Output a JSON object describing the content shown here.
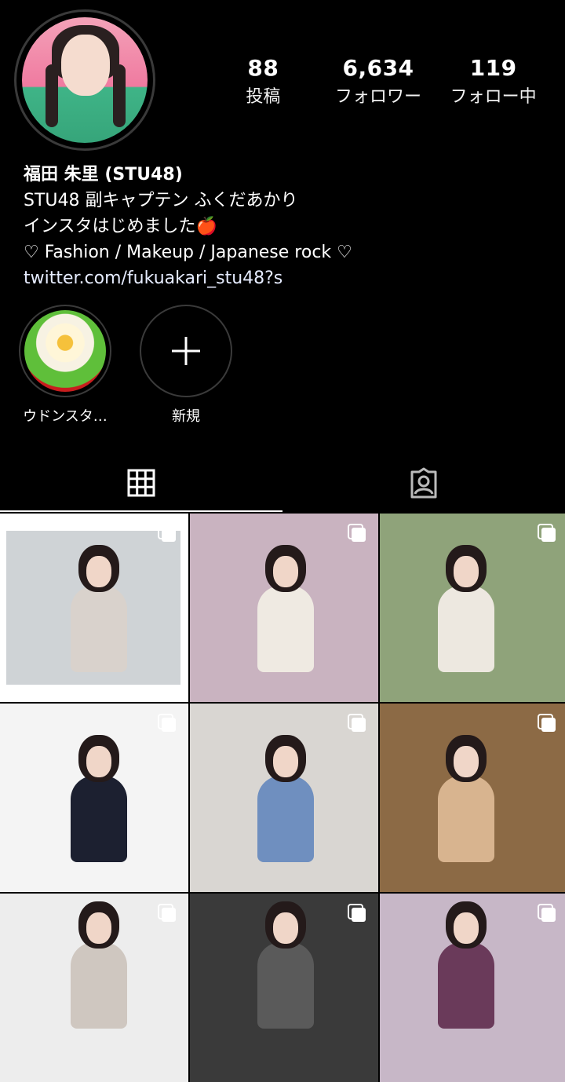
{
  "profile": {
    "stats": [
      {
        "value": "88",
        "label": "投稿"
      },
      {
        "value": "6,634",
        "label": "フォロワー"
      },
      {
        "value": "119",
        "label": "フォロー中"
      }
    ],
    "name": "福田 朱里 (STU48)",
    "bio_lines": [
      "STU48 副キャプテン ふくだあかり",
      "インスタはじめました🍎",
      "♡ Fashion / Makeup / Japanese rock ♡"
    ],
    "link": "twitter.com/fukuakari_stu48?s"
  },
  "highlights": [
    {
      "label": "ウドンスタ…"
    },
    {
      "label": "新規",
      "icon": "plus-icon"
    }
  ],
  "tabs": [
    {
      "icon": "grid-icon",
      "active": true
    },
    {
      "icon": "tagged-person-icon",
      "active": false
    }
  ],
  "posts": [
    {
      "bg": "#d8d8d8",
      "frame": true,
      "outfit": "#d9d2cc",
      "multi": true
    },
    {
      "bg": "#c9b3c0",
      "frame": false,
      "outfit": "#efeae2",
      "multi": true
    },
    {
      "bg": "#8fa37a",
      "frame": false,
      "outfit": "#ede8e0",
      "multi": true
    },
    {
      "bg": "#f4f4f4",
      "frame": false,
      "outfit": "#1c2030",
      "multi": true
    },
    {
      "bg": "#d9d6d2",
      "frame": false,
      "outfit": "#6f8fbf",
      "multi": true
    },
    {
      "bg": "#8c6a45",
      "frame": false,
      "outfit": "#d8b48f",
      "multi": true
    },
    {
      "bg": "#ededed",
      "frame": false,
      "outfit": "#cfc7c0",
      "multi": true
    },
    {
      "bg": "#3a3a3a",
      "frame": false,
      "outfit": "#5a5a5a",
      "multi": true
    },
    {
      "bg": "#c7b7c7",
      "frame": false,
      "outfit": "#6a3a5a",
      "multi": true
    }
  ]
}
